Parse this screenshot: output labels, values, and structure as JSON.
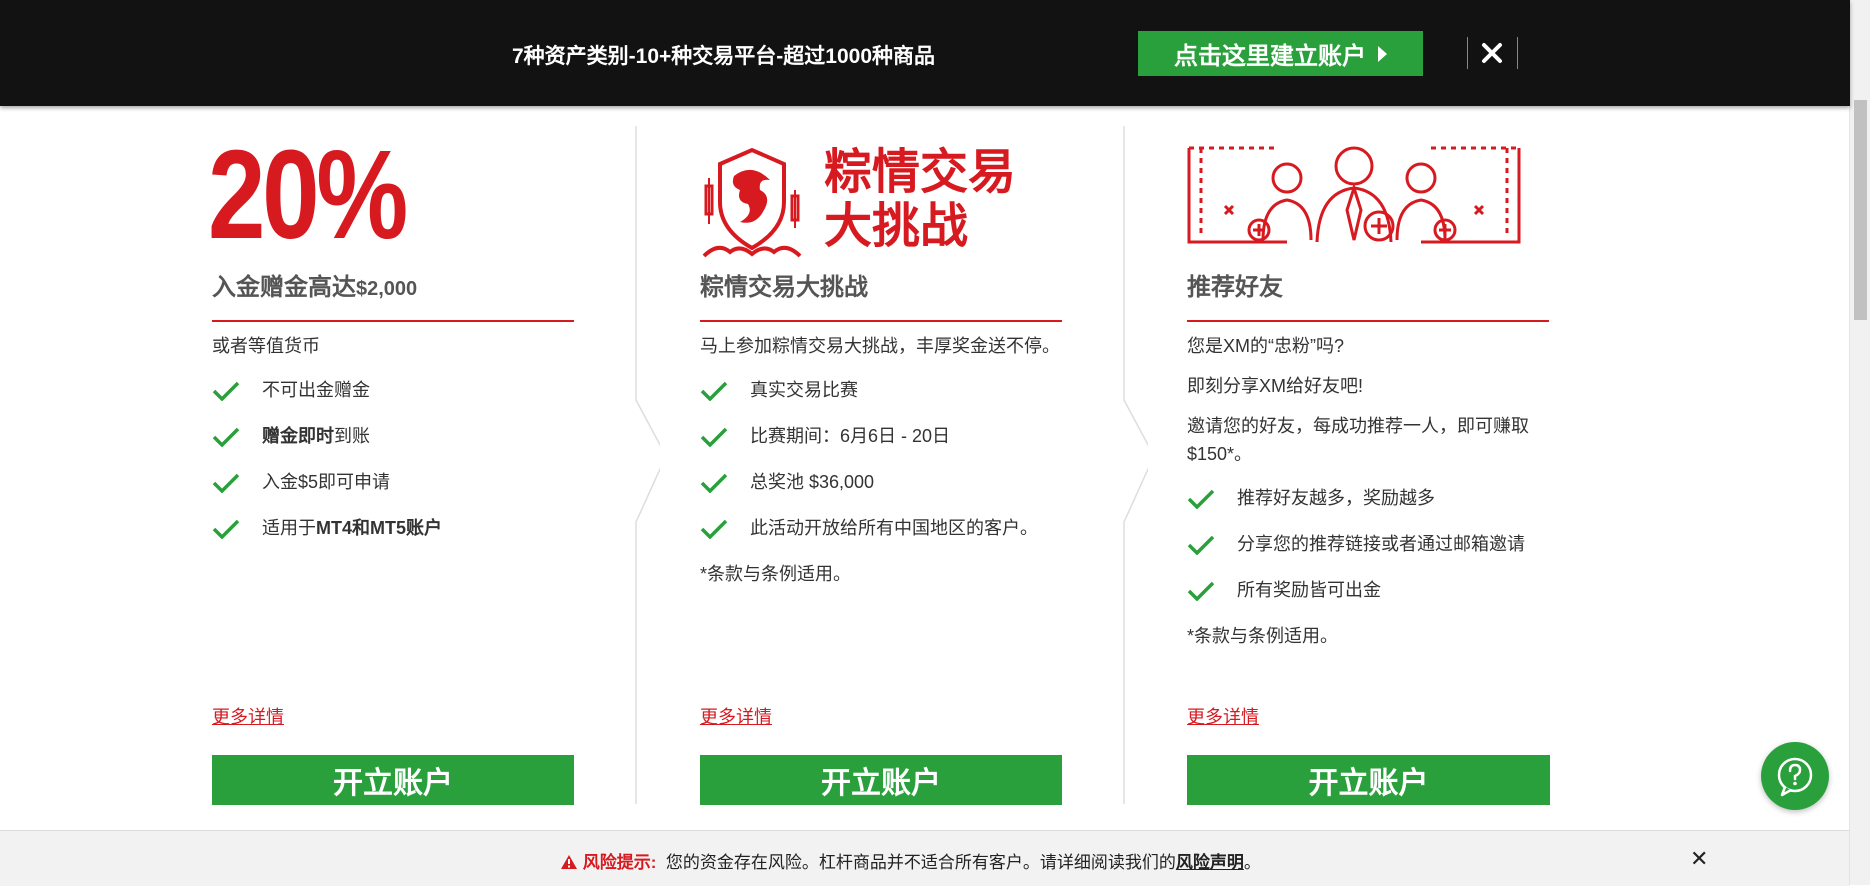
{
  "topbar": {
    "text": "7种资产类别-10+种交易平台-超过1000种商品",
    "cta_label": "点击这里建立账户",
    "close_icon": "close-icon"
  },
  "colors": {
    "brand_red": "#d71920",
    "green": "#2aa03c",
    "topbar_bg": "#121212"
  },
  "columns": [
    {
      "hero_text": "20%",
      "title": "入金赠金高达",
      "title_suffix": "$2,000",
      "intro": "或者等值货币",
      "items": [
        {
          "bold": "",
          "text": "不可出金赠金"
        },
        {
          "bold": "赠金即时",
          "text": "到账"
        },
        {
          "bold": "",
          "text": "入金$5即可申请"
        },
        {
          "bold_prefix": "适用于",
          "bold": "MT4和MT5账户"
        }
      ],
      "more_link": "更多详情",
      "button": "开立账户"
    },
    {
      "hero_icon": "dragon-shield-icon",
      "hero_line1": "粽情交易",
      "hero_line2": "大挑战",
      "title": "粽情交易大挑战",
      "intro": "马上参加粽情交易大挑战，丰厚奖金送不停。",
      "items": [
        "真实交易比赛",
        "比赛期间：6月6日 - 20日",
        "总奖池 $36,000",
        "此活动开放给所有中国地区的客户。"
      ],
      "terms": "*条款与条例适用。",
      "more_link": "更多详情",
      "button": "开立账户"
    },
    {
      "hero_icon": "refer-friends-icon",
      "title": "推荐好友",
      "intro_lines": [
        "您是XM的“忠粉”吗?",
        "即刻分享XM给好友吧!",
        "邀请您的好友，每成功推荐一人，即可赚取$150*。"
      ],
      "items": [
        "推荐好友越多，奖励越多",
        "分享您的推荐链接或者通过邮箱邀请",
        "所有奖励皆可出金"
      ],
      "terms": "*条款与条例适用。",
      "more_link": "更多详情",
      "button": "开立账户"
    }
  ],
  "risk": {
    "label": "风险提示:",
    "text": "您的资金存在风险。杠杆商品并不适合所有客户。请详细阅读我们的",
    "link": "风险声明",
    "end": "。"
  },
  "help_icon": "help-chat-icon"
}
